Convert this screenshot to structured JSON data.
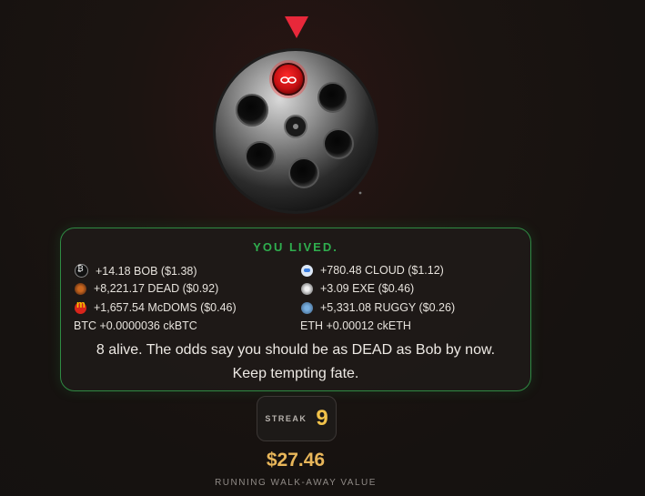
{
  "result": {
    "title": "YOU LIVED.",
    "rewards": [
      {
        "text": "+14.18 BOB ($1.38)",
        "icon": "bob-coin-icon"
      },
      {
        "text": "+780.48 CLOUD ($1.12)",
        "icon": "cloud-coin-icon"
      },
      {
        "text": "+8,221.17 DEAD ($0.92)",
        "icon": "dead-coin-icon"
      },
      {
        "text": "+3.09 EXE ($0.46)",
        "icon": "exe-coin-icon"
      },
      {
        "text": "+1,657.54 McDOMS ($0.46)",
        "icon": "mcdoms-coin-icon"
      },
      {
        "text": "+5,331.08 RUGGY ($0.26)",
        "icon": "ruggy-coin-icon"
      },
      {
        "text": "BTC +0.0000036 ckBTC"
      },
      {
        "text": "ETH +0.00012 ckETH"
      }
    ],
    "odds_line1": "8 alive. The odds say you should be as DEAD as Bob by now.",
    "odds_line2": "Keep tempting fate."
  },
  "streak": {
    "label": "STREAK",
    "value": "9"
  },
  "walk_away": {
    "value": "$27.46",
    "label": "RUNNING WALK-AWAY VALUE"
  },
  "colors": {
    "alive_green": "#2fae4e",
    "gold": "#f1c24a",
    "pointer_red": "#e8283a"
  }
}
